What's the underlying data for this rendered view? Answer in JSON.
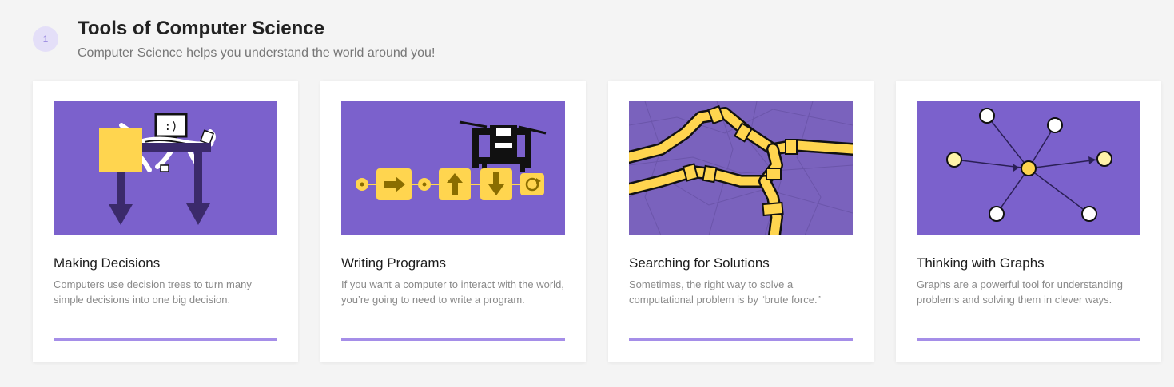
{
  "section": {
    "step_number": "1",
    "title": "Tools of Computer Science",
    "subtitle": "Computer Science helps you understand the world around you!"
  },
  "colors": {
    "card_image_background": "#7b61cc",
    "accent_yellow": "#ffd54f",
    "progress_bar": "#a58ee8",
    "badge_background": "#e4dff8",
    "dark_purple": "#3b2a6b"
  },
  "cards": [
    {
      "title": "Making Decisions",
      "description": "Computers use decision trees to turn many simple decisions into one big decision.",
      "illustration": "decision-tree-robot-icon"
    },
    {
      "title": "Writing Programs",
      "description": "If you want a computer to interact with the world, you’re going to need to write a program.",
      "illustration": "drone-program-icon"
    },
    {
      "title": "Searching for Solutions",
      "description": "Sometimes, the right way to solve a computational problem is by “brute force.”",
      "illustration": "map-roads-icon"
    },
    {
      "title": "Thinking with Graphs",
      "description": "Graphs are a powerful tool for understanding problems and solving them in clever ways.",
      "illustration": "graph-network-icon"
    }
  ]
}
